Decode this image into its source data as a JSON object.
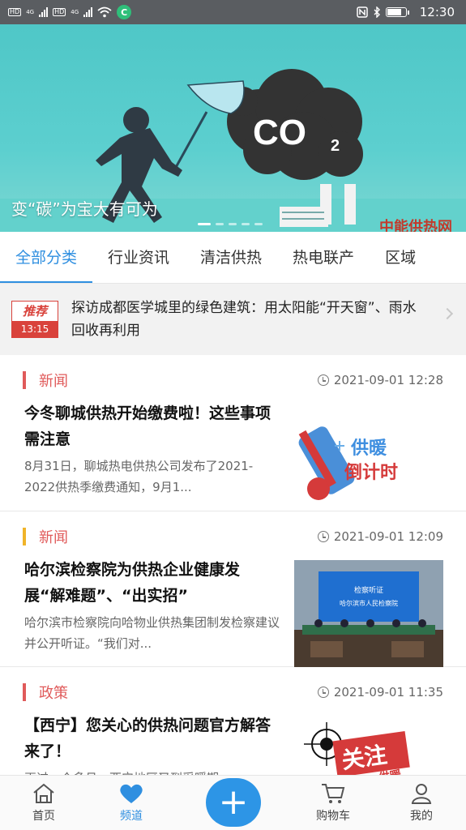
{
  "status_bar": {
    "time": "12:30",
    "hd1": "HD",
    "hd2": "HD",
    "net1": "4G",
    "net2": "4G",
    "app_badge": "C"
  },
  "banner": {
    "caption": "变“碳”为宝大有可为",
    "co2_label": "CO",
    "co2_sub": "2",
    "watermark": "中能供热网",
    "slide_count": 5,
    "active_slide": 1
  },
  "tabs": [
    {
      "label": "全部分类",
      "active": true
    },
    {
      "label": "行业资讯",
      "active": false
    },
    {
      "label": "清洁供热",
      "active": false
    },
    {
      "label": "热电联产",
      "active": false
    },
    {
      "label": "区域",
      "active": false
    }
  ],
  "recommend": {
    "badge": "推荐",
    "time": "13:15",
    "text": "探访成都医学城里的绿色建筑：用太阳能“开天窗”、雨水回收再利用"
  },
  "news": [
    {
      "category": "新闻",
      "category_color": "#e05a5a",
      "time": "2021-09-01 12:28",
      "title": "今冬聊城供热开始缴费啦！这些事项需注意",
      "summary": "8月31日，聊城热电供热公司发布了2021-2022供热季缴费通知，9月1...",
      "thumb_text1": "供暖",
      "thumb_text2": "倒计时"
    },
    {
      "category": "新闻",
      "category_color": "#f0b429",
      "time": "2021-09-01 12:09",
      "title": "哈尔滨检察院为供热企业健康发展“解难题”、“出实招”",
      "summary": "哈尔滨市检察院向哈物业供热集团制发检察建议并公开听证。“我们对...",
      "thumb_text1": "检察听证",
      "thumb_text2": "哈尔滨市人民检察院"
    },
    {
      "category": "政策",
      "category_color": "#e05a5a",
      "time": "2021-09-01 11:35",
      "title": "【西宁】您关心的供热问题官方解答来了！",
      "summary": "再过一个多月，西宁地区又到采暖期",
      "thumb_text1": "关注",
      "thumb_text2": "供暖"
    }
  ],
  "bottom_nav": [
    {
      "label": "首页",
      "icon": "home-icon",
      "active": false
    },
    {
      "label": "频道",
      "icon": "heart-icon",
      "active": true
    },
    {
      "label": "+",
      "icon": "plus-icon",
      "active": false
    },
    {
      "label": "购物车",
      "icon": "cart-icon",
      "active": false
    },
    {
      "label": "我的",
      "icon": "user-icon",
      "active": false
    }
  ],
  "colors": {
    "accent": "#2f8fe0",
    "red": "#d9423b",
    "banner_bg": "#55caca"
  }
}
